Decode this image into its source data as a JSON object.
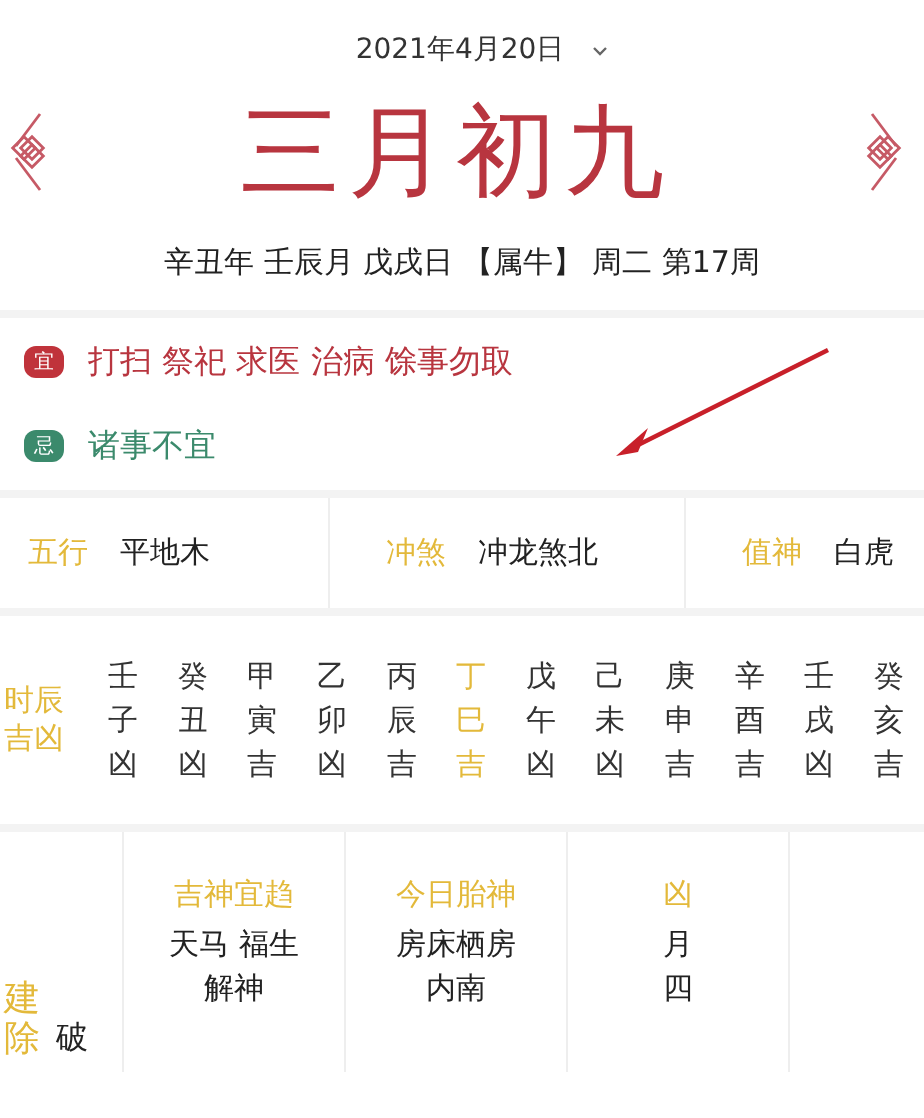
{
  "date_picker": {
    "date": "2021年4月20日"
  },
  "lunar_date": "三月初九",
  "ganzhi": "辛丑年 壬辰月 戊戌日 【属牛】 周二 第17周",
  "yi_ji": [
    {
      "kind": "good",
      "badge": "宜",
      "text": "打扫 祭祀 求医 治病 馀事勿取"
    },
    {
      "kind": "bad",
      "badge": "忌",
      "text": "诸事不宜"
    }
  ],
  "info": [
    {
      "label": "五行",
      "value": "平地木"
    },
    {
      "label": "冲煞",
      "value": "冲龙煞北"
    },
    {
      "label": "值神",
      "value": "白虎"
    }
  ],
  "shichen": {
    "label": [
      "时辰",
      "吉凶"
    ],
    "hours": [
      {
        "stem": "壬",
        "branch": "子",
        "luck": "凶",
        "selected": false
      },
      {
        "stem": "癸",
        "branch": "丑",
        "luck": "凶",
        "selected": false
      },
      {
        "stem": "甲",
        "branch": "寅",
        "luck": "吉",
        "selected": false
      },
      {
        "stem": "乙",
        "branch": "卯",
        "luck": "凶",
        "selected": false
      },
      {
        "stem": "丙",
        "branch": "辰",
        "luck": "吉",
        "selected": false
      },
      {
        "stem": "丁",
        "branch": "巳",
        "luck": "吉",
        "selected": true
      },
      {
        "stem": "戊",
        "branch": "午",
        "luck": "凶",
        "selected": false
      },
      {
        "stem": "己",
        "branch": "未",
        "luck": "凶",
        "selected": false
      },
      {
        "stem": "庚",
        "branch": "申",
        "luck": "吉",
        "selected": false
      },
      {
        "stem": "辛",
        "branch": "酉",
        "luck": "吉",
        "selected": false
      },
      {
        "stem": "壬",
        "branch": "戌",
        "luck": "凶",
        "selected": false
      },
      {
        "stem": "癸",
        "branch": "亥",
        "luck": "吉",
        "selected": false
      }
    ]
  },
  "jianchu": {
    "label": "建除",
    "value": "破"
  },
  "gods": [
    {
      "title": "吉神宜趋",
      "lines": [
        "天马 福生",
        "解神"
      ]
    },
    {
      "title": "今日胎神",
      "lines": [
        "房床栖房",
        "内南"
      ]
    },
    {
      "title": "凶",
      "lines": [
        "月",
        "四"
      ]
    }
  ]
}
